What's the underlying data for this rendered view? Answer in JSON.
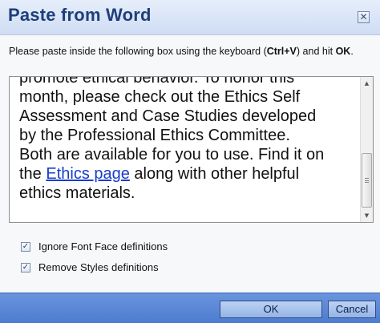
{
  "dialog": {
    "title": "Paste from Word",
    "close_glyph": "✕",
    "close_icon": "close-icon"
  },
  "instruction": {
    "before": "Please paste inside the following box using the keyboard (",
    "shortcut": "Ctrl+V",
    "middle": ") and hit",
    "ok_word": "OK",
    "end": "."
  },
  "pastebox": {
    "lines": {
      "l0": "promote ethical behavior.  To honor this",
      "l1": "month, please check out the Ethics Self",
      "l2": "Assessment and Case Studies developed",
      "l3": "by the Professional Ethics Committee.",
      "l4": "Both are available for you to use.  Find it on",
      "l5_before": "the ",
      "l5_link": "Ethics page",
      "l5_after": " along with other helpful",
      "l6": "ethics materials."
    },
    "scroll_up_glyph": "▲",
    "scroll_down_glyph": "▼",
    "scroll_position_fraction": 0.62
  },
  "options": {
    "ignore_font_face": {
      "label": "Ignore Font Face definitions",
      "checked": true,
      "check_glyph": "✓"
    },
    "remove_styles": {
      "label": "Remove Styles definitions",
      "checked": true,
      "check_glyph": "✓"
    }
  },
  "footer": {
    "ok_label": "OK",
    "cancel_label": "Cancel"
  },
  "colors": {
    "title_text": "#1e3f7a",
    "footer_bg": "#5a86d6",
    "link": "#1a3dcc"
  }
}
